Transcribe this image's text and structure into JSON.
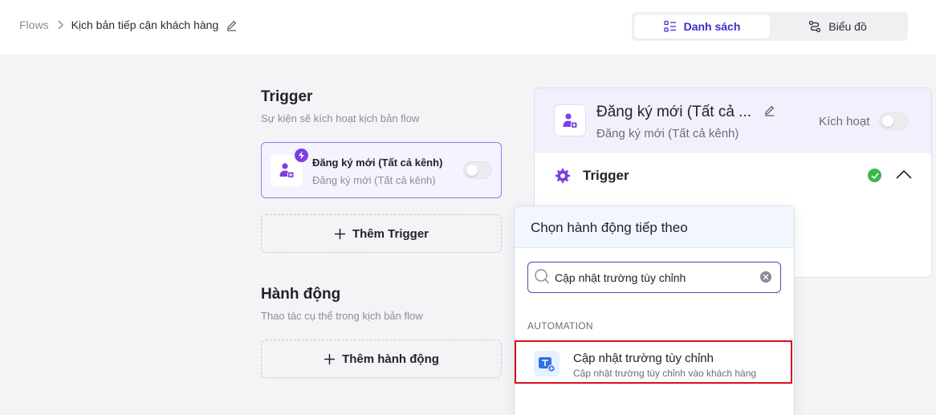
{
  "breadcrumb": {
    "root": "Flows",
    "current": "Kịch bản tiếp cận khách hàng"
  },
  "view_toggle": {
    "list_label": "Danh sách",
    "diagram_label": "Biểu đồ",
    "active": "list"
  },
  "trigger_section": {
    "title": "Trigger",
    "subtitle": "Sự kiện sẽ kích hoạt kịch bản flow",
    "card": {
      "title": "Đăng ký mới (Tất cả kênh)",
      "subtitle": "Đăng ký mới (Tất cả kênh)",
      "enabled": false
    },
    "add_label": "Thêm Trigger"
  },
  "action_section": {
    "title": "Hành động",
    "subtitle": "Thao tác cụ thể trong kịch bản flow",
    "add_label": "Thêm hành động"
  },
  "detail_panel": {
    "title": "Đăng ký mới (Tất cả ...",
    "subtitle": "Đăng ký mới (Tất cả kênh)",
    "activate_label": "Kích hoạt",
    "activated": false,
    "trigger_label": "Trigger"
  },
  "action_popup": {
    "title": "Chọn hành động tiếp theo",
    "search_value": "Cập nhật trường tùy chỉnh",
    "group_label": "AUTOMATION",
    "items": [
      {
        "title": "Cập nhật trường tùy chỉnh",
        "subtitle": "Cập nhật trường tùy chỉnh vào khách hàng"
      }
    ]
  },
  "colors": {
    "accent": "#3b2fc9",
    "purple": "#7b3fe4",
    "success": "#3cb84a",
    "highlight_border": "#d90f1a"
  },
  "icons": [
    "pencil-icon",
    "chevron-right-icon",
    "list-icon",
    "flow-diagram-icon",
    "user-add-icon",
    "bolt-icon",
    "plus-icon",
    "gear-icon",
    "check-icon",
    "chevron-up-icon",
    "search-icon",
    "clear-icon",
    "text-field-icon"
  ]
}
